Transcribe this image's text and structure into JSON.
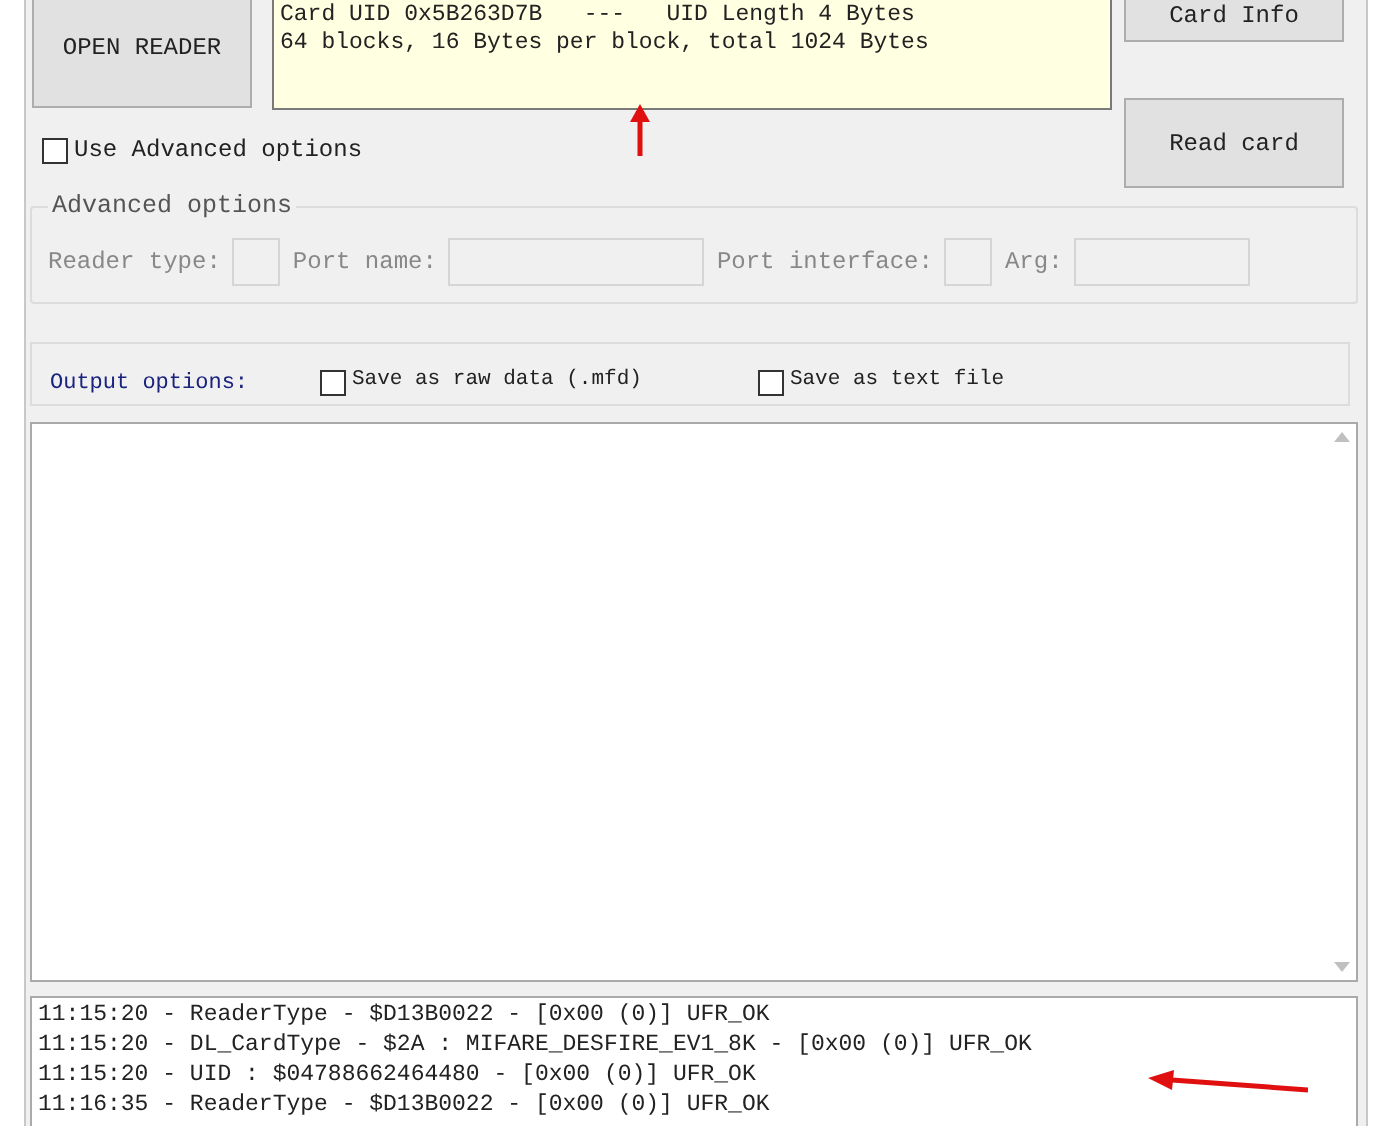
{
  "open_reader_button": "OPEN READER",
  "card_info_text": [
    "Card UID 0x5B263D7B   ---   UID Length 4 Bytes",
    "64 blocks, 16 Bytes per block, total 1024 Bytes"
  ],
  "card_info_button": "Card Info",
  "read_card_button": "Read card",
  "use_advanced": {
    "label": "Use Advanced options",
    "checked": false
  },
  "advanced_options": {
    "title": "Advanced options",
    "fields": [
      {
        "label": "Reader type:"
      },
      {
        "label": "Port name:"
      },
      {
        "label": "Port interface:"
      },
      {
        "label": "Arg:"
      }
    ]
  },
  "output_options": {
    "label": "Output options:",
    "checkboxes": [
      {
        "label": "Save as raw data (.mfd)",
        "checked": false
      },
      {
        "label": "Save as text file",
        "checked": false
      }
    ]
  },
  "log": [
    "11:15:20 - ReaderType - $D13B0022 - [0x00 (0)] UFR_OK",
    "11:15:20 - DL_CardType - $2A : MIFARE_DESFIRE_EV1_8K - [0x00 (0)] UFR_OK",
    "11:15:20 - UID : $04788662464480 - [0x00 (0)] UFR_OK",
    "11:16:35 - ReaderType - $D13B0022 - [0x00 (0)] UFR_OK"
  ]
}
